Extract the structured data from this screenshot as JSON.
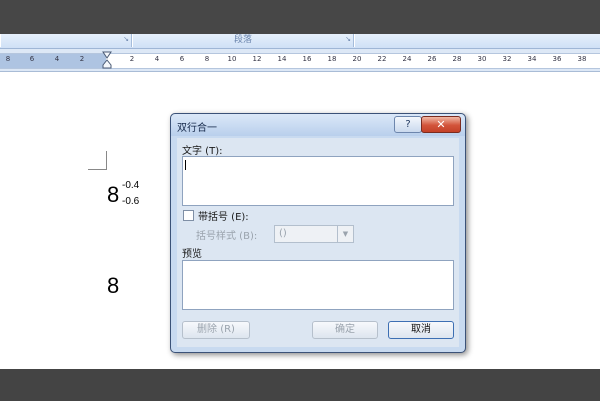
{
  "ribbon": {
    "group_label": "段落",
    "launcher_glyph": "↘"
  },
  "ruler": {
    "ticks": [
      "8",
      "6",
      "4",
      "2",
      "2",
      "4",
      "6",
      "8",
      "10",
      "12",
      "14",
      "16",
      "18",
      "20",
      "22",
      "24",
      "26",
      "28",
      "30",
      "32",
      "34",
      "36",
      "38"
    ]
  },
  "document": {
    "first_base": "8",
    "first_sup": "-0.4",
    "first_sub": "-0.6",
    "second_base": "8"
  },
  "dialog": {
    "title": "双行合一",
    "help_glyph": "?",
    "close_glyph": "✕",
    "text_label": "文字 (T):",
    "text_value": "",
    "brackets_label": "带括号 (E):",
    "bracket_style_label": "括号样式 (B):",
    "bracket_style_value": "()",
    "preview_label": "预览",
    "delete_label": "删除 (R)",
    "ok_label": "确定",
    "cancel_label": "取消"
  }
}
